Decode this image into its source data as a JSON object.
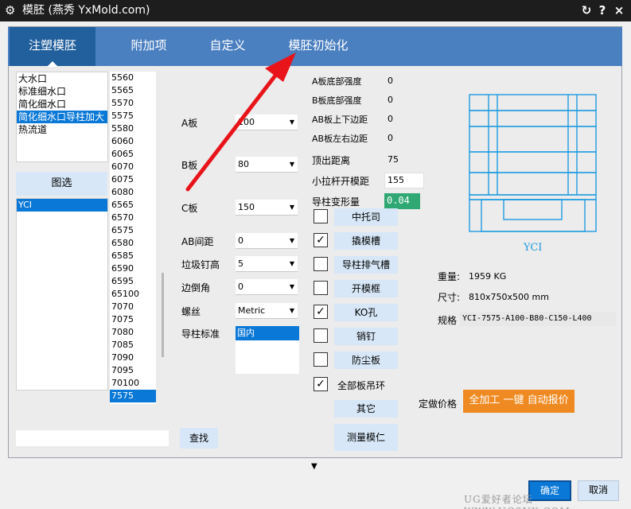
{
  "window": {
    "title": "模胚  (燕秀 YxMold.com)",
    "icons": [
      "gear-icon",
      "refresh-icon",
      "help-icon",
      "close-icon"
    ],
    "help_glyph": "?",
    "close_glyph": "×"
  },
  "tabs": [
    "注塑模胚",
    "附加项",
    "自定义",
    "模胚初始化"
  ],
  "type_list": {
    "items": [
      "大水口",
      "标准细水口",
      "简化细水口",
      "简化细水口导柱加大",
      "热流道"
    ],
    "selected_index": 3
  },
  "pick_button": "图选",
  "series_list": {
    "items": [
      "YCI"
    ],
    "selected_index": 0
  },
  "size_list": {
    "items": [
      "5560",
      "5565",
      "5570",
      "5575",
      "5580",
      "6060",
      "6065",
      "6070",
      "6075",
      "6080",
      "6565",
      "6570",
      "6575",
      "6580",
      "6585",
      "6590",
      "6595",
      "65100",
      "7070",
      "7075",
      "7080",
      "7085",
      "7090",
      "7095",
      "70100",
      "7575"
    ],
    "selected_index": 25
  },
  "search_button": "查找",
  "params": {
    "a_plate": {
      "label": "A板",
      "value": "100"
    },
    "b_plate": {
      "label": "B板",
      "value": "80"
    },
    "c_plate": {
      "label": "C板",
      "value": "150"
    },
    "ab_gap": {
      "label": "AB间距",
      "value": "0"
    },
    "trash_pin": {
      "label": "垃圾钉高",
      "value": "5"
    },
    "chamfer": {
      "label": "边倒角",
      "value": "0"
    },
    "thread": {
      "label": "螺丝",
      "value": "Metric"
    },
    "guide_std": {
      "label": "导柱标准",
      "value": "国内"
    }
  },
  "strengths": [
    {
      "label": "A板底部强度",
      "value": "0"
    },
    {
      "label": "B板底部强度",
      "value": "0"
    },
    {
      "label": "AB板上下边距",
      "value": "0"
    },
    {
      "label": "AB板左右边距",
      "value": "0"
    },
    {
      "label": "顶出距离",
      "value": "75"
    }
  ],
  "pull_rod": {
    "label": "小拉杆开模距",
    "value": "155"
  },
  "guide_deform": {
    "label": "导柱变形量",
    "value": "0.04",
    "color": "#2fa873"
  },
  "options": [
    {
      "label": "中托司",
      "checked": false
    },
    {
      "label": "撬模槽",
      "checked": true
    },
    {
      "label": "导柱排气槽",
      "checked": false
    },
    {
      "label": "开模框",
      "checked": false
    },
    {
      "label": "KO孔",
      "checked": true
    },
    {
      "label": "销钉",
      "checked": false
    },
    {
      "label": "防尘板",
      "checked": false
    },
    {
      "label": "全部板吊环",
      "checked": true
    }
  ],
  "other_button": "其它",
  "measure_button": "测量模仁",
  "diagram_label": "YCI",
  "info": {
    "weight_label": "重量:",
    "weight_value": "1959 KG",
    "size_label": "尺寸:",
    "size_value": "810x750x500 mm",
    "spec_label": "规格",
    "spec_value": "YCI-7575-A100-B80-C150-L400"
  },
  "price": {
    "label": "定做价格",
    "button": "全加工 一键 自动报价",
    "color": "#ef8a22"
  },
  "expand_glyph": "▼",
  "footer": {
    "ok": "确定",
    "cancel": "取消"
  },
  "watermark": "UG爱好者论坛 WWW.UGSNX.COM",
  "colors": {
    "tab_bar": "#4a7fc0",
    "tab_active": "#215f9d",
    "selection": "#0a78d7",
    "button_bg": "#d7e7f7",
    "arrow": "#e8141a"
  }
}
